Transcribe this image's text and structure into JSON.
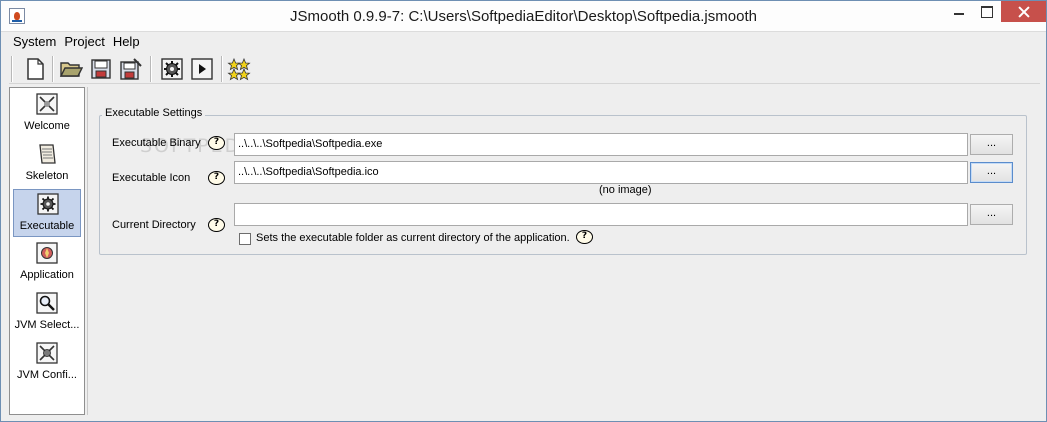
{
  "window": {
    "title": "JSmooth 0.9.9-7: C:\\Users\\SoftpediaEditor\\Desktop\\Softpedia.jsmooth"
  },
  "menubar": {
    "items": [
      "System",
      "Project",
      "Help"
    ]
  },
  "toolbar": {
    "buttons": [
      "new-icon",
      "open-folder-icon",
      "save-icon",
      "save-as-icon",
      "compile-gear-icon",
      "run-icon",
      "wizard-stars-icon"
    ]
  },
  "sidebar": {
    "items": [
      {
        "label": "Welcome",
        "icon": "welcome-icon"
      },
      {
        "label": "Skeleton",
        "icon": "skeleton-icon"
      },
      {
        "label": "Executable",
        "icon": "executable-gear-icon",
        "active": true
      },
      {
        "label": "Application",
        "icon": "application-icon"
      },
      {
        "label": "JVM Select...",
        "icon": "jvm-select-icon"
      },
      {
        "label": "JVM Confi...",
        "icon": "jvm-config-icon"
      }
    ]
  },
  "executable_settings": {
    "group_title": "Executable Settings",
    "binary_label": "Executable Binary",
    "binary_value": "..\\..\\..\\Softpedia\\Softpedia.exe",
    "icon_label": "Executable Icon",
    "icon_value": "..\\..\\..\\Softpedia\\Softpedia.ico",
    "icon_preview": "(no image)",
    "directory_label": "Current Directory",
    "directory_value": "",
    "browse_label": "...",
    "help_label": "?",
    "checkbox_label": "Sets the executable folder as current directory of the application.",
    "checkbox_checked": false
  },
  "watermark": "SOFTPEDIA"
}
